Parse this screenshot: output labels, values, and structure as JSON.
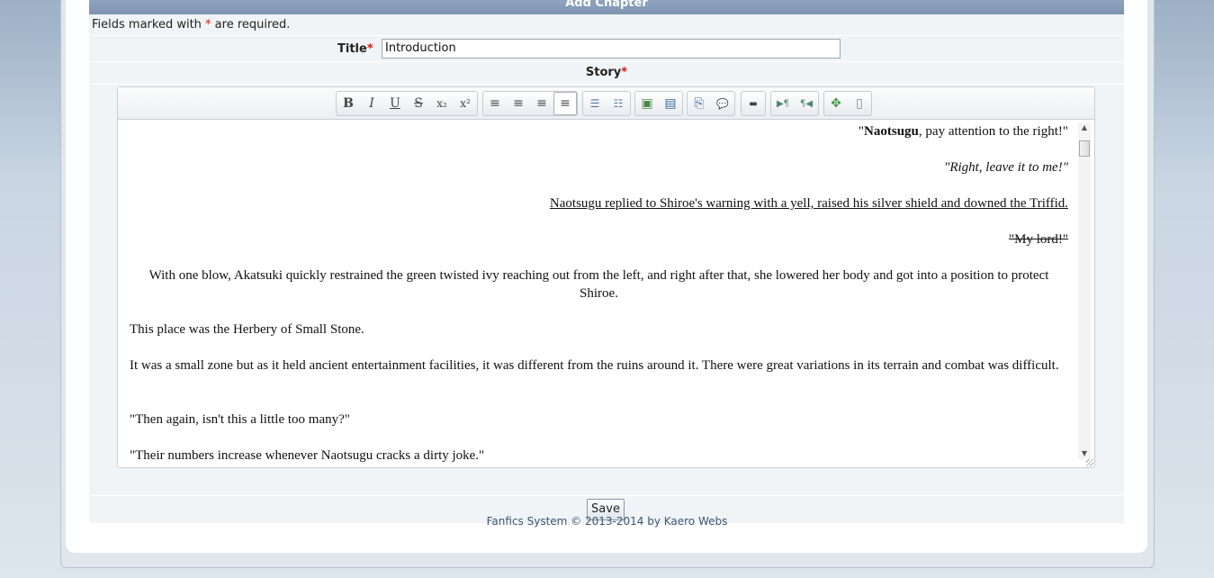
{
  "header": {
    "title": "Add Chapter"
  },
  "required_note": {
    "prefix": "Fields marked with ",
    "star": "*",
    "suffix": " are required."
  },
  "title_field": {
    "label": "Title",
    "star": "*",
    "value": "Introduction"
  },
  "story_field": {
    "label": "Story",
    "star": "*"
  },
  "toolbar": {
    "buttons": [
      {
        "name": "bold-icon",
        "glyph": "B"
      },
      {
        "name": "italic-icon",
        "glyph": "I"
      },
      {
        "name": "underline-icon",
        "glyph": "U"
      },
      {
        "name": "strikethrough-icon",
        "glyph": "S"
      },
      {
        "name": "subscript-icon",
        "glyph": "x₂"
      },
      {
        "name": "superscript-icon",
        "glyph": "x²"
      },
      {
        "name": "align-left-icon",
        "glyph": "≡"
      },
      {
        "name": "align-center-icon",
        "glyph": "≡"
      },
      {
        "name": "align-right-icon",
        "glyph": "≡"
      },
      {
        "name": "justify-icon",
        "glyph": "≡"
      },
      {
        "name": "bulleted-list-icon",
        "glyph": "☰"
      },
      {
        "name": "numbered-list-icon",
        "glyph": "☷"
      },
      {
        "name": "insert-image-icon",
        "glyph": "▣"
      },
      {
        "name": "insert-media-icon",
        "glyph": "▤"
      },
      {
        "name": "paste-icon",
        "glyph": "⎘"
      },
      {
        "name": "comment-icon",
        "glyph": "💬"
      },
      {
        "name": "horizontal-rule-icon",
        "glyph": "▬"
      },
      {
        "name": "ltr-icon",
        "glyph": "▶¶"
      },
      {
        "name": "rtl-icon",
        "glyph": "¶◀"
      },
      {
        "name": "maximize-icon",
        "glyph": "✥"
      },
      {
        "name": "source-icon",
        "glyph": "▯"
      }
    ]
  },
  "story": {
    "p1_bold": "Naotsugu",
    "p1_before": "\"",
    "p1_after": ", pay attention to the right!\"",
    "p2": "\"Right, leave it to me!\"",
    "p3": "Naotsugu replied to Shiroe's warning with a yell, raised his silver shield and downed the Triffid.",
    "p4": "\"My lord!\"",
    "p5": "With one blow, Akatsuki quickly restrained the green twisted ivy reaching out from the left, and right after that, she lowered her body and got into a position to protect Shiroe.",
    "p6": "This place was the Herbery of Small Stone.",
    "p7": "It was a small zone but as it held ancient entertainment facilities, it was different from the ruins around it. There were great variations in its terrain and combat was difficult.",
    "p8": "\"Then again, isn't this a little too many?\"",
    "p9": "\"Their numbers increase whenever Naotsugu cracks a dirty joke.\""
  },
  "save_button": {
    "label": "Save"
  },
  "footer": {
    "text": "Fanfics System © 2013-2014 by Kaero Webs"
  }
}
